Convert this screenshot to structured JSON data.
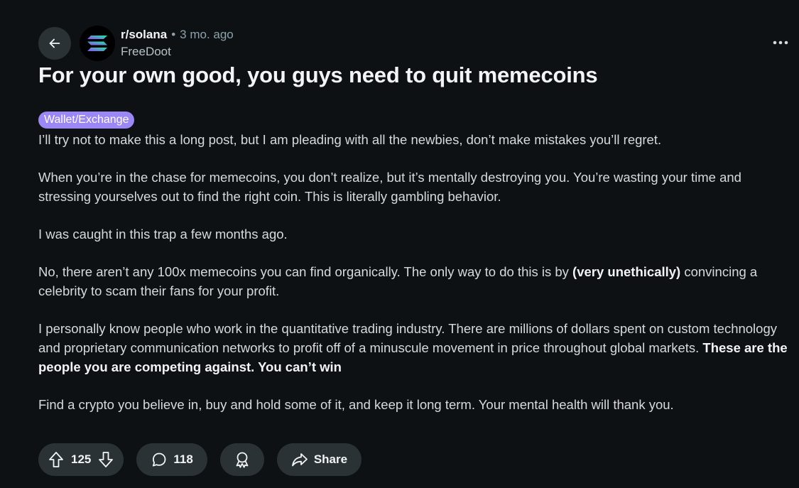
{
  "post": {
    "subreddit": "r/solana",
    "separator": "•",
    "time_ago": "3 mo. ago",
    "author": "FreeDoot",
    "title": "For your own good, you guys need to quit memecoins",
    "flair": "Wallet/Exchange",
    "body": {
      "p1": "I’ll try not to make this a long post, but I am pleading with all the newbies, don’t make mistakes you’ll regret.",
      "p2": "When you’re in the chase for memecoins, you don’t realize, but it’s mentally destroying you. You’re wasting your time and stressing yourselves out to find the right coin. This is literally gambling behavior.",
      "p3": "I was caught in this trap a few months ago.",
      "p4a": "No, there aren’t any 100x memecoins you can find organically. The only way to do this is by ",
      "p4b": "(very unethically)",
      "p4c": " convincing a celebrity to scam their fans for your profit.",
      "p5a": "I personally know people who work in the quantitative trading industry. There are millions of dollars spent on custom technology and proprietary communication networks to profit off of a minuscule movement in price throughout global markets. ",
      "p5b": "These are the people you are competing against. You can’t win",
      "p6": "Find a crypto you believe in, buy and hold some of it, and keep it long term. Your mental health will thank you."
    }
  },
  "actions": {
    "votes": "125",
    "comments": "118",
    "share_label": "Share"
  },
  "icons": {
    "back": "arrow-left-icon",
    "subreddit": "solana-logo-icon",
    "more": "more-horizontal-icon",
    "upvote": "upvote-arrow-icon",
    "downvote": "downvote-arrow-icon",
    "comment": "comment-bubble-icon",
    "award": "award-icon",
    "share": "share-arrow-icon"
  },
  "colors": {
    "background": "#0e1113",
    "pill": "#2a3236",
    "flair": "#9b87f5",
    "text": "#d7dadc"
  }
}
